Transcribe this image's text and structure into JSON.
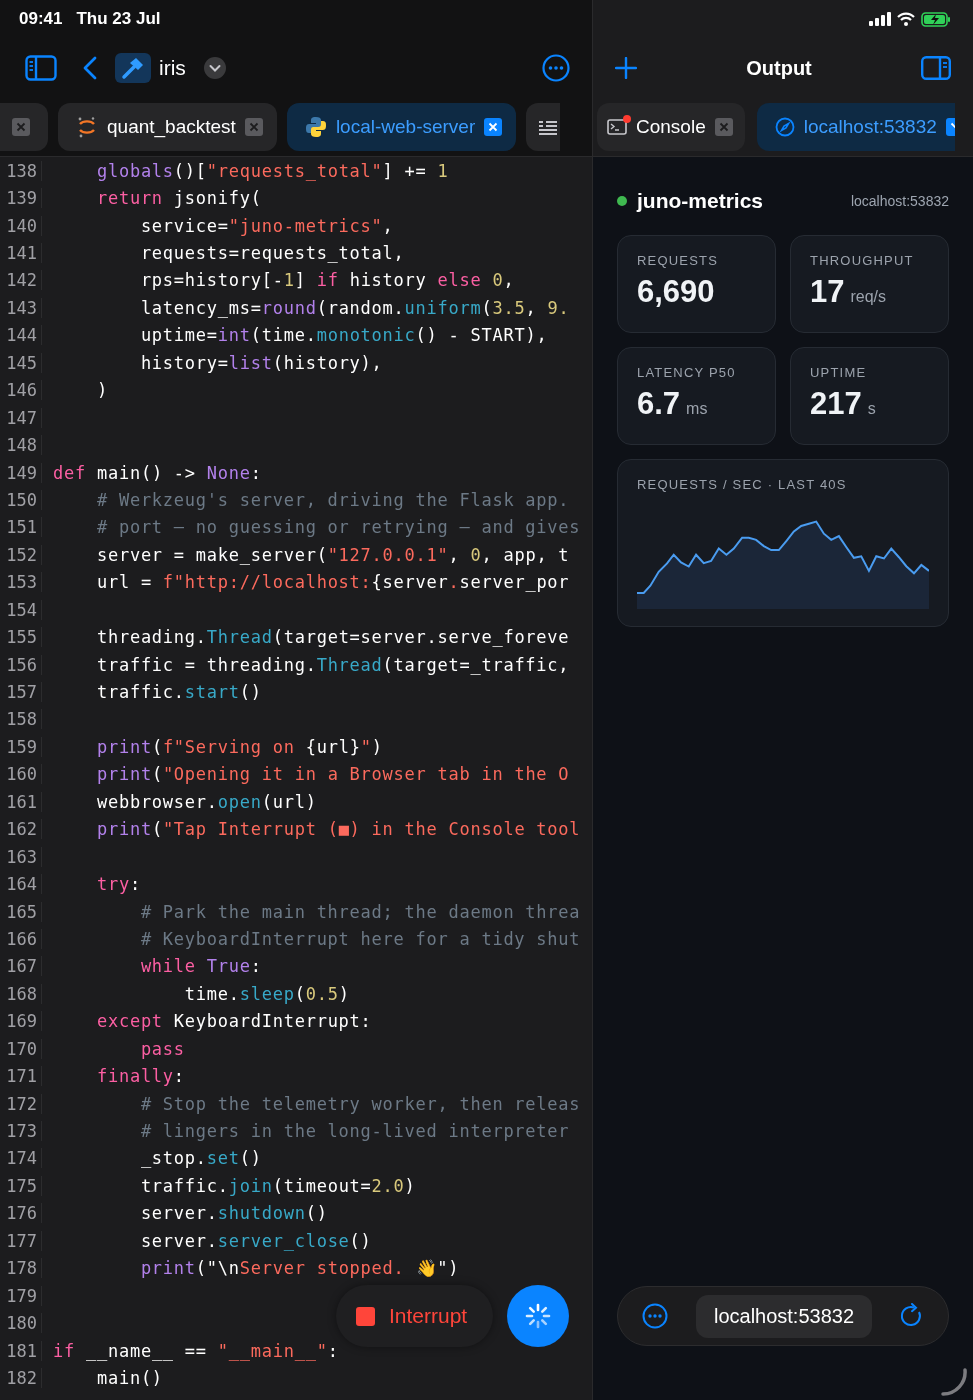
{
  "status_bar": {
    "time": "09:41",
    "date": "Thu 23 Jul"
  },
  "toolbar": {
    "project": "iris"
  },
  "editor_tabs": [
    {
      "kind": "cut",
      "selected": false
    },
    {
      "kind": "notebook",
      "label": "quant_backtest",
      "selected": false
    },
    {
      "kind": "python",
      "label": "local-web-server",
      "selected": true
    },
    {
      "kind": "list",
      "selected": false
    }
  ],
  "code": {
    "lines": [
      {
        "num": "138",
        "tokens": [
          {
            "t": "    globals",
            "kind": "builtin"
          },
          {
            "t": "()[",
            "kind": "plain"
          },
          {
            "t": "\"requests_total\"",
            "kind": "string"
          },
          {
            "t": "] += ",
            "kind": "plain"
          },
          {
            "t": "1",
            "kind": "number"
          }
        ]
      },
      {
        "num": "139",
        "tokens": [
          {
            "t": "    return",
            "kind": "keyword"
          },
          {
            "t": " jsonify(",
            "kind": "plain"
          }
        ]
      },
      {
        "num": "140",
        "tokens": [
          {
            "t": "        service=",
            "kind": "plain"
          },
          {
            "t": "\"juno-metrics\"",
            "kind": "string"
          },
          {
            "t": ",",
            "kind": "plain"
          }
        ]
      },
      {
        "num": "141",
        "tokens": [
          {
            "t": "        requests=requests_total,",
            "kind": "plain"
          }
        ]
      },
      {
        "num": "142",
        "tokens": [
          {
            "t": "        rps=history[-",
            "kind": "plain"
          },
          {
            "t": "1",
            "kind": "number"
          },
          {
            "t": "] ",
            "kind": "plain"
          },
          {
            "t": "if",
            "kind": "keyword"
          },
          {
            "t": " history ",
            "kind": "plain"
          },
          {
            "t": "else ",
            "kind": "keyword"
          },
          {
            "t": "0",
            "kind": "number"
          },
          {
            "t": ",",
            "kind": "plain"
          }
        ]
      },
      {
        "num": "143",
        "tokens": [
          {
            "t": "        latency_ms=",
            "kind": "plain"
          },
          {
            "t": "round",
            "kind": "builtin"
          },
          {
            "t": "(random.",
            "kind": "plain"
          },
          {
            "t": "uniform",
            "kind": "call"
          },
          {
            "t": "(",
            "kind": "plain"
          },
          {
            "t": "3.5",
            "kind": "number"
          },
          {
            "t": ", ",
            "kind": "plain"
          },
          {
            "t": "9.",
            "kind": "number"
          }
        ]
      },
      {
        "num": "144",
        "tokens": [
          {
            "t": "        uptime=",
            "kind": "plain"
          },
          {
            "t": "int",
            "kind": "builtin"
          },
          {
            "t": "(time.",
            "kind": "plain"
          },
          {
            "t": "monotonic",
            "kind": "call"
          },
          {
            "t": "() - START),",
            "kind": "plain"
          }
        ]
      },
      {
        "num": "145",
        "tokens": [
          {
            "t": "        history=",
            "kind": "plain"
          },
          {
            "t": "list",
            "kind": "builtin"
          },
          {
            "t": "(history),",
            "kind": "plain"
          }
        ]
      },
      {
        "num": "146",
        "tokens": [
          {
            "t": "    )",
            "kind": "plain"
          }
        ]
      },
      {
        "num": "147"
      },
      {
        "num": "148"
      },
      {
        "num": "149",
        "tokens": [
          {
            "t": "def",
            "kind": "keyword"
          },
          {
            "t": " main() -> ",
            "kind": "plain"
          },
          {
            "t": "None",
            "kind": "builtin"
          },
          {
            "t": ":",
            "kind": "plain"
          }
        ]
      },
      {
        "num": "150",
        "tokens": [
          {
            "t": "    # Werkzeug's server, driving the Flask app.",
            "kind": "comment"
          }
        ]
      },
      {
        "num": "151",
        "tokens": [
          {
            "t": "    # port — no guessing or retrying — and gives",
            "kind": "comment"
          }
        ]
      },
      {
        "num": "152",
        "tokens": [
          {
            "t": "    server = make_server(",
            "kind": "plain"
          },
          {
            "t": "\"127.0.0.1\"",
            "kind": "string"
          },
          {
            "t": ", ",
            "kind": "plain"
          },
          {
            "t": "0",
            "kind": "number"
          },
          {
            "t": ", app, t",
            "kind": "plain"
          }
        ]
      },
      {
        "num": "153",
        "tokens": [
          {
            "t": "    url = ",
            "kind": "plain"
          },
          {
            "t": "f\"http://localhost:",
            "kind": "string"
          },
          {
            "t": "{server",
            "kind": "plain"
          },
          {
            "t": ".",
            "kind": "string"
          },
          {
            "t": "server_por",
            "kind": "plain"
          }
        ]
      },
      {
        "num": "154"
      },
      {
        "num": "155",
        "tokens": [
          {
            "t": "    threading.",
            "kind": "plain"
          },
          {
            "t": "Thread",
            "kind": "call"
          },
          {
            "t": "(target=server.serve_foreve",
            "kind": "plain"
          }
        ]
      },
      {
        "num": "156",
        "tokens": [
          {
            "t": "    traffic = threading.",
            "kind": "plain"
          },
          {
            "t": "Thread",
            "kind": "call"
          },
          {
            "t": "(target=_traffic,",
            "kind": "plain"
          }
        ]
      },
      {
        "num": "157",
        "tokens": [
          {
            "t": "    traffic.",
            "kind": "plain"
          },
          {
            "t": "start",
            "kind": "call"
          },
          {
            "t": "()",
            "kind": "plain"
          }
        ]
      },
      {
        "num": "158"
      },
      {
        "num": "159",
        "tokens": [
          {
            "t": "    print",
            "kind": "builtin"
          },
          {
            "t": "(",
            "kind": "plain"
          },
          {
            "t": "f\"Serving on ",
            "kind": "string"
          },
          {
            "t": "{url}",
            "kind": "plain"
          },
          {
            "t": "\"",
            "kind": "string"
          },
          {
            "t": ")",
            "kind": "plain"
          }
        ]
      },
      {
        "num": "160",
        "tokens": [
          {
            "t": "    print",
            "kind": "builtin"
          },
          {
            "t": "(",
            "kind": "plain"
          },
          {
            "t": "\"Opening it in a Browser tab in the O",
            "kind": "string"
          }
        ]
      },
      {
        "num": "161",
        "tokens": [
          {
            "t": "    webbrowser.",
            "kind": "plain"
          },
          {
            "t": "open",
            "kind": "call"
          },
          {
            "t": "(url)",
            "kind": "plain"
          }
        ]
      },
      {
        "num": "162",
        "tokens": [
          {
            "t": "    print",
            "kind": "builtin"
          },
          {
            "t": "(",
            "kind": "plain"
          },
          {
            "t": "\"Tap Interrupt (■) in the Console tool",
            "kind": "string"
          }
        ]
      },
      {
        "num": "163"
      },
      {
        "num": "164",
        "tokens": [
          {
            "t": "    try",
            "kind": "keyword"
          },
          {
            "t": ":",
            "kind": "plain"
          }
        ]
      },
      {
        "num": "165",
        "tokens": [
          {
            "t": "        # Park the main thread; the daemon threa",
            "kind": "comment"
          }
        ]
      },
      {
        "num": "166",
        "tokens": [
          {
            "t": "        # KeyboardInterrupt here for a tidy shut",
            "kind": "comment"
          }
        ]
      },
      {
        "num": "167",
        "tokens": [
          {
            "t": "        while ",
            "kind": "keyword"
          },
          {
            "t": "True",
            "kind": "builtin"
          },
          {
            "t": ":",
            "kind": "plain"
          }
        ]
      },
      {
        "num": "168",
        "tokens": [
          {
            "t": "            time.",
            "kind": "plain"
          },
          {
            "t": "sleep",
            "kind": "call"
          },
          {
            "t": "(",
            "kind": "plain"
          },
          {
            "t": "0.5",
            "kind": "number"
          },
          {
            "t": ")",
            "kind": "plain"
          }
        ]
      },
      {
        "num": "169",
        "tokens": [
          {
            "t": "    except",
            "kind": "keyword"
          },
          {
            "t": " KeyboardInterrupt:",
            "kind": "plain"
          }
        ]
      },
      {
        "num": "170",
        "tokens": [
          {
            "t": "        pass",
            "kind": "keyword"
          }
        ]
      },
      {
        "num": "171",
        "tokens": [
          {
            "t": "    finally",
            "kind": "keyword"
          },
          {
            "t": ":",
            "kind": "plain"
          }
        ]
      },
      {
        "num": "172",
        "tokens": [
          {
            "t": "        # Stop the telemetry worker, then releas",
            "kind": "comment"
          }
        ]
      },
      {
        "num": "173",
        "tokens": [
          {
            "t": "        # lingers in the long-lived interpreter",
            "kind": "comment"
          }
        ]
      },
      {
        "num": "174",
        "tokens": [
          {
            "t": "        _stop.",
            "kind": "plain"
          },
          {
            "t": "set",
            "kind": "call"
          },
          {
            "t": "()",
            "kind": "plain"
          }
        ]
      },
      {
        "num": "175",
        "tokens": [
          {
            "t": "        traffic.",
            "kind": "plain"
          },
          {
            "t": "join",
            "kind": "call"
          },
          {
            "t": "(timeout=",
            "kind": "plain"
          },
          {
            "t": "2.0",
            "kind": "number"
          },
          {
            "t": ")",
            "kind": "plain"
          }
        ]
      },
      {
        "num": "176",
        "tokens": [
          {
            "t": "        server.",
            "kind": "plain"
          },
          {
            "t": "shutdown",
            "kind": "call"
          },
          {
            "t": "()",
            "kind": "plain"
          }
        ]
      },
      {
        "num": "177",
        "tokens": [
          {
            "t": "        server.",
            "kind": "plain"
          },
          {
            "t": "server_close",
            "kind": "call"
          },
          {
            "t": "()",
            "kind": "plain"
          }
        ]
      },
      {
        "num": "178",
        "tokens": [
          {
            "t": "        print",
            "kind": "builtin"
          },
          {
            "t": "(\"\\n",
            "kind": "plain"
          },
          {
            "t": "Server stopped. ",
            "kind": "string"
          },
          {
            "t": "👋\")",
            "kind": "plain"
          }
        ]
      },
      {
        "num": "179"
      },
      {
        "num": "180"
      },
      {
        "num": "181",
        "tokens": [
          {
            "t": "if",
            "kind": "keyword"
          },
          {
            "t": " __name__ == ",
            "kind": "plain"
          },
          {
            "t": "\"__main__\"",
            "kind": "string"
          },
          {
            "t": ":",
            "kind": "plain"
          }
        ]
      },
      {
        "num": "182",
        "tokens": [
          {
            "t": "    main()",
            "kind": "plain"
          }
        ]
      }
    ]
  },
  "run_controls": {
    "interrupt": "Interrupt",
    "running": true
  },
  "output": {
    "title": "Output",
    "tabs": [
      {
        "kind": "console",
        "label": "Console",
        "selected": false,
        "badge": true
      },
      {
        "kind": "browser",
        "label": "localhost:53832",
        "selected": true
      }
    ]
  },
  "dashboard": {
    "service": "juno-metrics",
    "online": true,
    "host": "localhost:53832",
    "metrics": [
      {
        "label": "REQUESTS",
        "value": "6,690"
      },
      {
        "label": "THROUGHPUT",
        "value": "17",
        "unit": "req/s"
      },
      {
        "label": "LATENCY P50",
        "value": "6.7",
        "unit": "ms"
      },
      {
        "label": "UPTIME",
        "value": "217",
        "unit": "s"
      }
    ],
    "chart_title": "REQUESTS / SEC · LAST 40S"
  },
  "address_bar": {
    "url": "localhost:53832"
  }
}
